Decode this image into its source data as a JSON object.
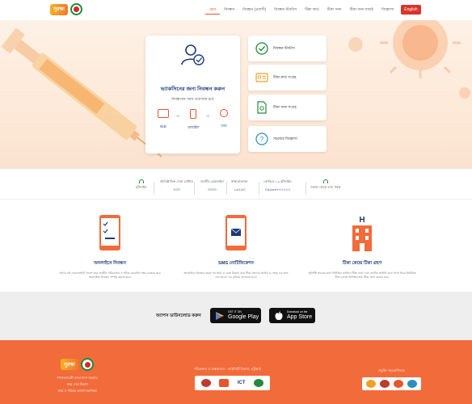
{
  "header": {
    "logo_text": "সুরক্ষা",
    "nav": [
      "হোম",
      "নিবন্ধন",
      "নিবন্ধন (প্রবাসী)",
      "নিবন্ধন স্ট্যাটাস",
      "টিকা কার্ড",
      "টিকা সনদ",
      "টিকা সনদ যাচাই",
      "জিজ্ঞাসা",
      "যোগাযোগ"
    ],
    "lang_button": "English"
  },
  "hero": {
    "reg_title": "ভ্যাকসিনের জন্য নিবন্ধন করুন",
    "reg_subtitle": "নিবন্ধনের সময় প্রয়োজন হবে",
    "steps": [
      "NID",
      "মোবাইল",
      "তথ্য"
    ],
    "side_cards": [
      "নিবন্ধন স্ট্যাটাস",
      "টিকা কার্ড সংগ্রহ",
      "টিকা সনদ সংগ্রহ",
      "সচরাচর জিজ্ঞাসা"
    ]
  },
  "stats": {
    "items": [
      {
        "title": "হটলাইন",
        "value": ""
      },
      {
        "title": "প্রাতিষ্ঠানিক সেবা সেন্টার",
        "value": "৩৩৩"
      },
      {
        "title": "জাতীয় হেল্পলাইন",
        "value": "৩৩৩০"
      },
      {
        "title": "স্বাস্থ্যবাতায়ন",
        "value": "১৬২৬৩"
      },
      {
        "title": "কোভিড-১৯ হটলাইন",
        "value": "০৯৬৬৬৭৭৭২২২"
      },
      {
        "title": "সকাল থেকে রাত পর্যন্ত",
        "value": ""
      }
    ]
  },
  "features": [
    {
      "title": "অনলাইনে নিবন্ধন",
      "desc": "প্রথমে এই ওয়েবসাইটে প্রবেশ করে জাতীয় পরিচয়পত্র ও সঠিক মোবাইল নম্বর ব্যবহার করে অনলাইনে নিবন্ধন সম্পন্ন করতে হবে।"
    },
    {
      "title": "SMS নোটিফিকেশন",
      "desc": "অনলাইনে নিবন্ধন করার পর সময় ও কেন্দ্র উল্লেখ করে টিকা গ্রহণের তারিখ ও ভেন্যু এর তথ্য এসএমএস এর মাধ্যমে জানানো হবে।"
    },
    {
      "title": "টিকা কেন্দ্রে টিকা গ্রহণ",
      "desc": "সুনির্দিষ্ট সময়ের জন্য নির্ধারিত তারিখে টিকা কার্ড এবং ভোটার আইডি কার্ড সাথে নিয়ে নির্ধারিত টিকা কেন্দ্রে উপস্থিত হয়ে টিকা গ্রহণ করতে হবে।"
    }
  ],
  "download": {
    "label": "অ্যাপস ডাউনলোড করুন",
    "google_small": "GET IT ON",
    "google_big": "Google Play",
    "apple_small": "Download on the",
    "apple_big": "App Store"
  },
  "footer": {
    "logo_text": "সুরক্ষা",
    "org1": "গণপ্রজাতন্ত্রী বাংলাদেশ সরকার",
    "org2": "স্বাস্থ্য সেবা বিভাগ",
    "org3": "স্বাস্থ্য ও পরিবার কল্যাণ মন্ত্রণালয়",
    "mid_title": "পরিকল্পনা ও বাস্তবায়নে - আইসিটি বিভাগ, এটুআই",
    "right_title": "প্রযুক্তি সহযোগিতায়",
    "ict_label": "ICT"
  },
  "colors": {
    "accent": "#e8552a",
    "navy": "#1c3a7a",
    "footer": "#f26b3a",
    "green": "#1e8c3a"
  }
}
